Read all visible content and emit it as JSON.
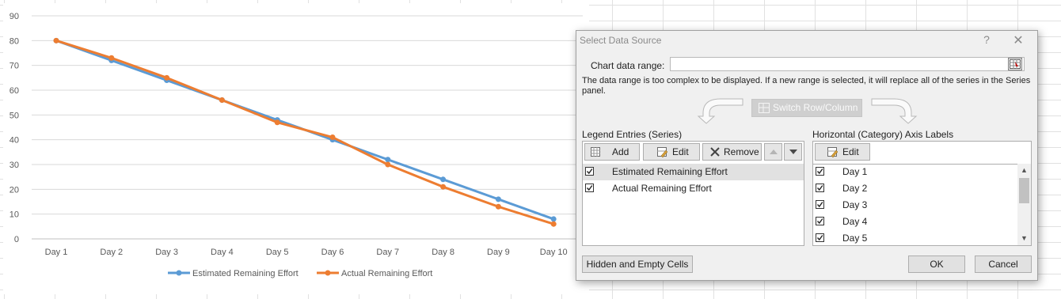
{
  "chart_data": {
    "type": "line",
    "categories": [
      "Day 1",
      "Day 2",
      "Day 3",
      "Day 4",
      "Day 5",
      "Day 6",
      "Day 7",
      "Day 8",
      "Day 9",
      "Day 10"
    ],
    "series": [
      {
        "name": "Estimated Remaining Effort",
        "values": [
          80,
          72,
          64,
          56,
          48,
          40,
          32,
          24,
          16,
          8
        ],
        "color": "#5b9bd5"
      },
      {
        "name": "Actual Remaining Effort",
        "values": [
          80,
          73,
          65,
          56,
          47,
          41,
          30,
          21,
          13,
          6
        ],
        "color": "#ed7d31"
      }
    ],
    "yticks": [
      0,
      10,
      20,
      30,
      40,
      50,
      60,
      70,
      80,
      90
    ],
    "ylim": [
      0,
      90
    ],
    "grid": true,
    "legend": "bottom"
  },
  "dialog": {
    "title": "Select Data Source",
    "help": "?",
    "close": "✕",
    "range_label": "Chart data range:",
    "range_value": "",
    "message": "The data range is too complex to be displayed. If a new range is selected, it will replace all of the series in the Series panel.",
    "switch_label": "Switch Row/Column",
    "legend_label": "Legend Entries (Series)",
    "axis_label": "Horizontal (Category) Axis Labels",
    "add": "Add",
    "edit": "Edit",
    "remove": "Remove",
    "axis_edit": "Edit",
    "series_items": [
      "Estimated Remaining Effort",
      "Actual Remaining Effort"
    ],
    "axis_items": [
      "Day 1",
      "Day 2",
      "Day 3",
      "Day 4",
      "Day 5"
    ],
    "hidden_cells": "Hidden and Empty Cells",
    "ok": "OK",
    "cancel": "Cancel"
  }
}
